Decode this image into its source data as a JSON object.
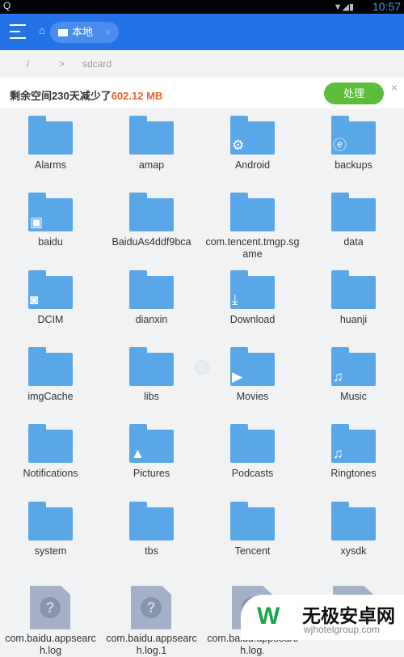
{
  "status": {
    "left": "Q",
    "time": "10:57"
  },
  "appbar": {
    "tab_label": "本地"
  },
  "breadcrumb": {
    "root": "/",
    "sep": ">",
    "current": "sdcard"
  },
  "banner": {
    "text": "剩余空间230天减少了",
    "amount": "602.12 MB",
    "button": "处理",
    "close": "×"
  },
  "colors": {
    "accent": "#2473e6",
    "folder": "#5aa7e8",
    "button": "#5cbe3b",
    "highlight": "#e8622f"
  },
  "items": [
    {
      "name": "Alarms",
      "type": "folder"
    },
    {
      "name": "amap",
      "type": "folder"
    },
    {
      "name": "Android",
      "type": "folder",
      "badge": "gear-icon"
    },
    {
      "name": "backups",
      "type": "folder",
      "badge": "es-icon"
    },
    {
      "name": "baidu",
      "type": "folder",
      "badge": "app-icon"
    },
    {
      "name": "BaiduAs4ddf9bca",
      "type": "folder"
    },
    {
      "name": "com.tencent.tmgp.sgame",
      "type": "folder"
    },
    {
      "name": "data",
      "type": "folder"
    },
    {
      "name": "DCIM",
      "type": "folder",
      "badge": "camera-icon"
    },
    {
      "name": "dianxin",
      "type": "folder"
    },
    {
      "name": "Download",
      "type": "folder",
      "badge": "download-icon"
    },
    {
      "name": "huanji",
      "type": "folder"
    },
    {
      "name": "imgCache",
      "type": "folder"
    },
    {
      "name": "libs",
      "type": "folder"
    },
    {
      "name": "Movies",
      "type": "folder",
      "badge": "play-icon"
    },
    {
      "name": "Music",
      "type": "folder",
      "badge": "music-icon"
    },
    {
      "name": "Notifications",
      "type": "folder"
    },
    {
      "name": "Pictures",
      "type": "folder",
      "badge": "image-icon"
    },
    {
      "name": "Podcasts",
      "type": "folder"
    },
    {
      "name": "Ringtones",
      "type": "folder",
      "badge": "music-icon"
    },
    {
      "name": "system",
      "type": "folder"
    },
    {
      "name": "tbs",
      "type": "folder"
    },
    {
      "name": "Tencent",
      "type": "folder"
    },
    {
      "name": "xysdk",
      "type": "folder"
    },
    {
      "name": "com.baidu.appsearch.log",
      "type": "file"
    },
    {
      "name": "com.baidu.appsearch.log.1",
      "type": "file"
    },
    {
      "name": "com.baidu.appsearch.log.",
      "type": "file"
    },
    {
      "name": "",
      "type": "file"
    }
  ],
  "watermark": {
    "title": "无极安卓网",
    "url": "wjhotelgroup.com"
  }
}
